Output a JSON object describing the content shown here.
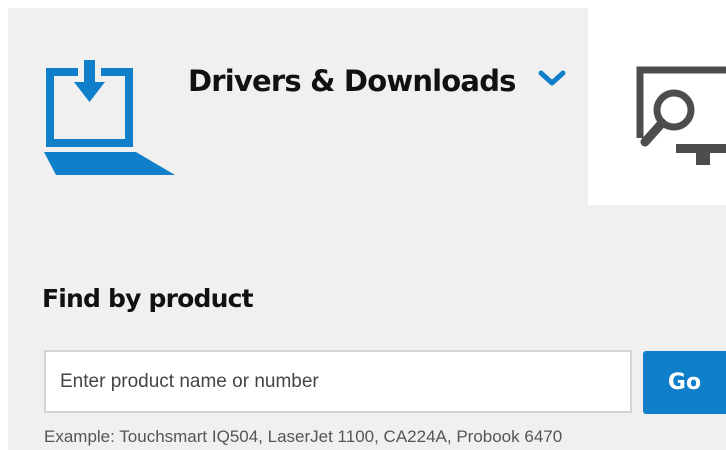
{
  "colors": {
    "accent": "#0f7fc9",
    "panel_background": "#f0f0f0",
    "icon_dark": "#4d4d4d"
  },
  "drivers_section": {
    "icon": "download-laptop-icon",
    "title": "Drivers & Downloads",
    "toggle_icon": "chevron-down-icon"
  },
  "adjacent_card": {
    "icon": "monitor-search-icon"
  },
  "find_by_product": {
    "title": "Find by product",
    "search": {
      "value": "",
      "placeholder": "Enter product name or number"
    },
    "go_label": "Go",
    "example": "Example: Touchsmart IQ504, LaserJet 1100, CA224A, Probook 6470"
  }
}
